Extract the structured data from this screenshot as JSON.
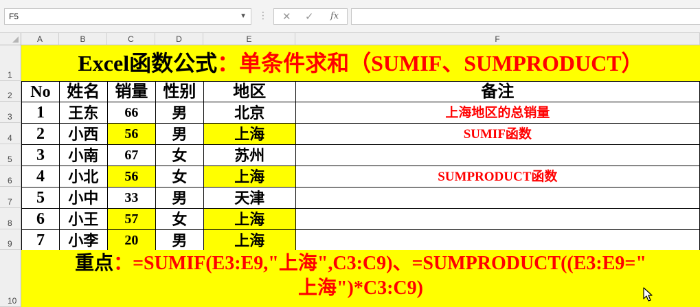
{
  "formula_bar": {
    "name_box": "F5",
    "cancel_icon": "✕",
    "confirm_icon": "✓",
    "fx_icon": "fx",
    "formula": ""
  },
  "columns": [
    "A",
    "B",
    "C",
    "D",
    "E",
    "F"
  ],
  "rows": [
    "1",
    "2",
    "3",
    "4",
    "5",
    "6",
    "7",
    "8",
    "9",
    "10"
  ],
  "title": {
    "black": "Excel函数公式",
    "red": "：单条件求和（SUMIF、SUMPRODUCT）"
  },
  "table": {
    "headers": [
      "No",
      "姓名",
      "销量",
      "性别",
      "地区",
      "备注"
    ],
    "rows": [
      {
        "no": "1",
        "name": "王东",
        "sales": "66",
        "gender": "男",
        "region": "北京",
        "note": "上海地区的总销量",
        "highlight": false
      },
      {
        "no": "2",
        "name": "小西",
        "sales": "56",
        "gender": "男",
        "region": "上海",
        "note": "SUMIF函数",
        "highlight": true
      },
      {
        "no": "3",
        "name": "小南",
        "sales": "67",
        "gender": "女",
        "region": "苏州",
        "note": "",
        "highlight": false
      },
      {
        "no": "4",
        "name": "小北",
        "sales": "56",
        "gender": "女",
        "region": "上海",
        "note": "SUMPRODUCT函数",
        "highlight": true
      },
      {
        "no": "5",
        "name": "小中",
        "sales": "33",
        "gender": "男",
        "region": "天津",
        "note": "",
        "highlight": false
      },
      {
        "no": "6",
        "name": "小王",
        "sales": "57",
        "gender": "女",
        "region": "上海",
        "note": "",
        "highlight": true
      },
      {
        "no": "7",
        "name": "小李",
        "sales": "20",
        "gender": "男",
        "region": "上海",
        "note": "",
        "highlight": true
      }
    ]
  },
  "bottom": {
    "label": "重点",
    "line1_rest": "：=SUMIF(E3:E9,\"上海\",C3:C9)、=SUMPRODUCT((E3:E9=\"",
    "line2": "上海\")*C3:C9)"
  },
  "colors": {
    "highlight": "#ffff00",
    "accent": "#ff0000"
  }
}
